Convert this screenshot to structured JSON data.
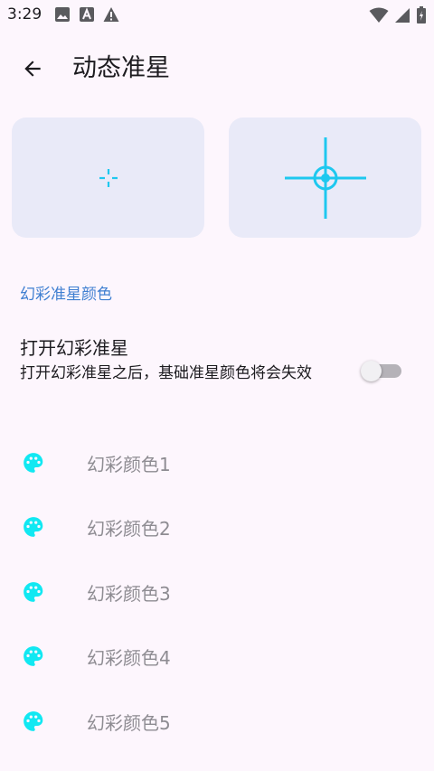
{
  "status_bar": {
    "time": "3:29",
    "left_icons": [
      "image-icon",
      "font-app-icon",
      "warning-icon"
    ],
    "right_icons": [
      "wifi-icon",
      "signal-icon",
      "battery-icon"
    ]
  },
  "app_bar": {
    "title": "动态准星",
    "back_icon": "arrow-back-icon"
  },
  "previews": {
    "accent_color": "#1ec8ef",
    "card_color": "#e9eaf8"
  },
  "section": {
    "title": "幻彩准星颜色"
  },
  "rainbow_toggle": {
    "title": "打开幻彩准星",
    "description": "打开幻彩准星之后，基础准星颜色将会失效",
    "enabled": false
  },
  "color_items": [
    {
      "label": "幻彩颜色1",
      "icon": "palette-icon",
      "icon_color": "#11e8f2"
    },
    {
      "label": "幻彩颜色2",
      "icon": "palette-icon",
      "icon_color": "#11e8f2"
    },
    {
      "label": "幻彩颜色3",
      "icon": "palette-icon",
      "icon_color": "#11e8f2"
    },
    {
      "label": "幻彩颜色4",
      "icon": "palette-icon",
      "icon_color": "#11e8f2"
    },
    {
      "label": "幻彩颜色5",
      "icon": "palette-icon",
      "icon_color": "#11e8f2"
    }
  ]
}
